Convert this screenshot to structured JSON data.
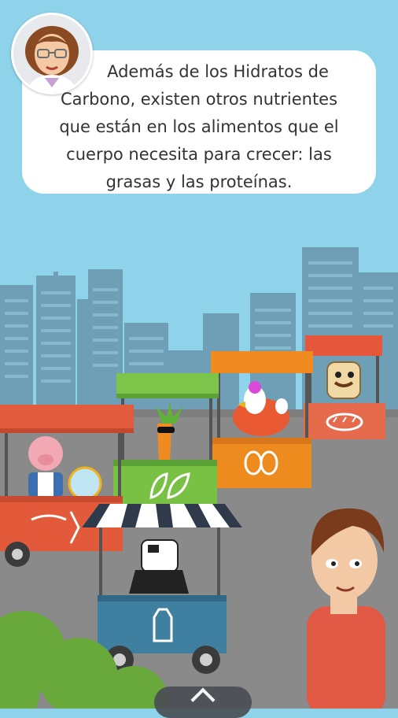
{
  "dialog": {
    "text": "Además de los Hidratos de Carbono, existen otros nutrientes que están en los alimentos que el cuerpo necesita para crecer: las grasas y las proteínas.",
    "speaker_icon": "teacher-avatar-icon"
  },
  "navigation": {
    "icon": "chevron-up-icon"
  },
  "colors": {
    "sky": "#8fd3ea",
    "buildings": "#6f9fb6",
    "street": "#8a8a8a",
    "stall_red": "#e25b3d",
    "stall_green": "#7dc44a",
    "stall_orange": "#ee8b1f",
    "stall_blue": "#3f7fa0"
  }
}
